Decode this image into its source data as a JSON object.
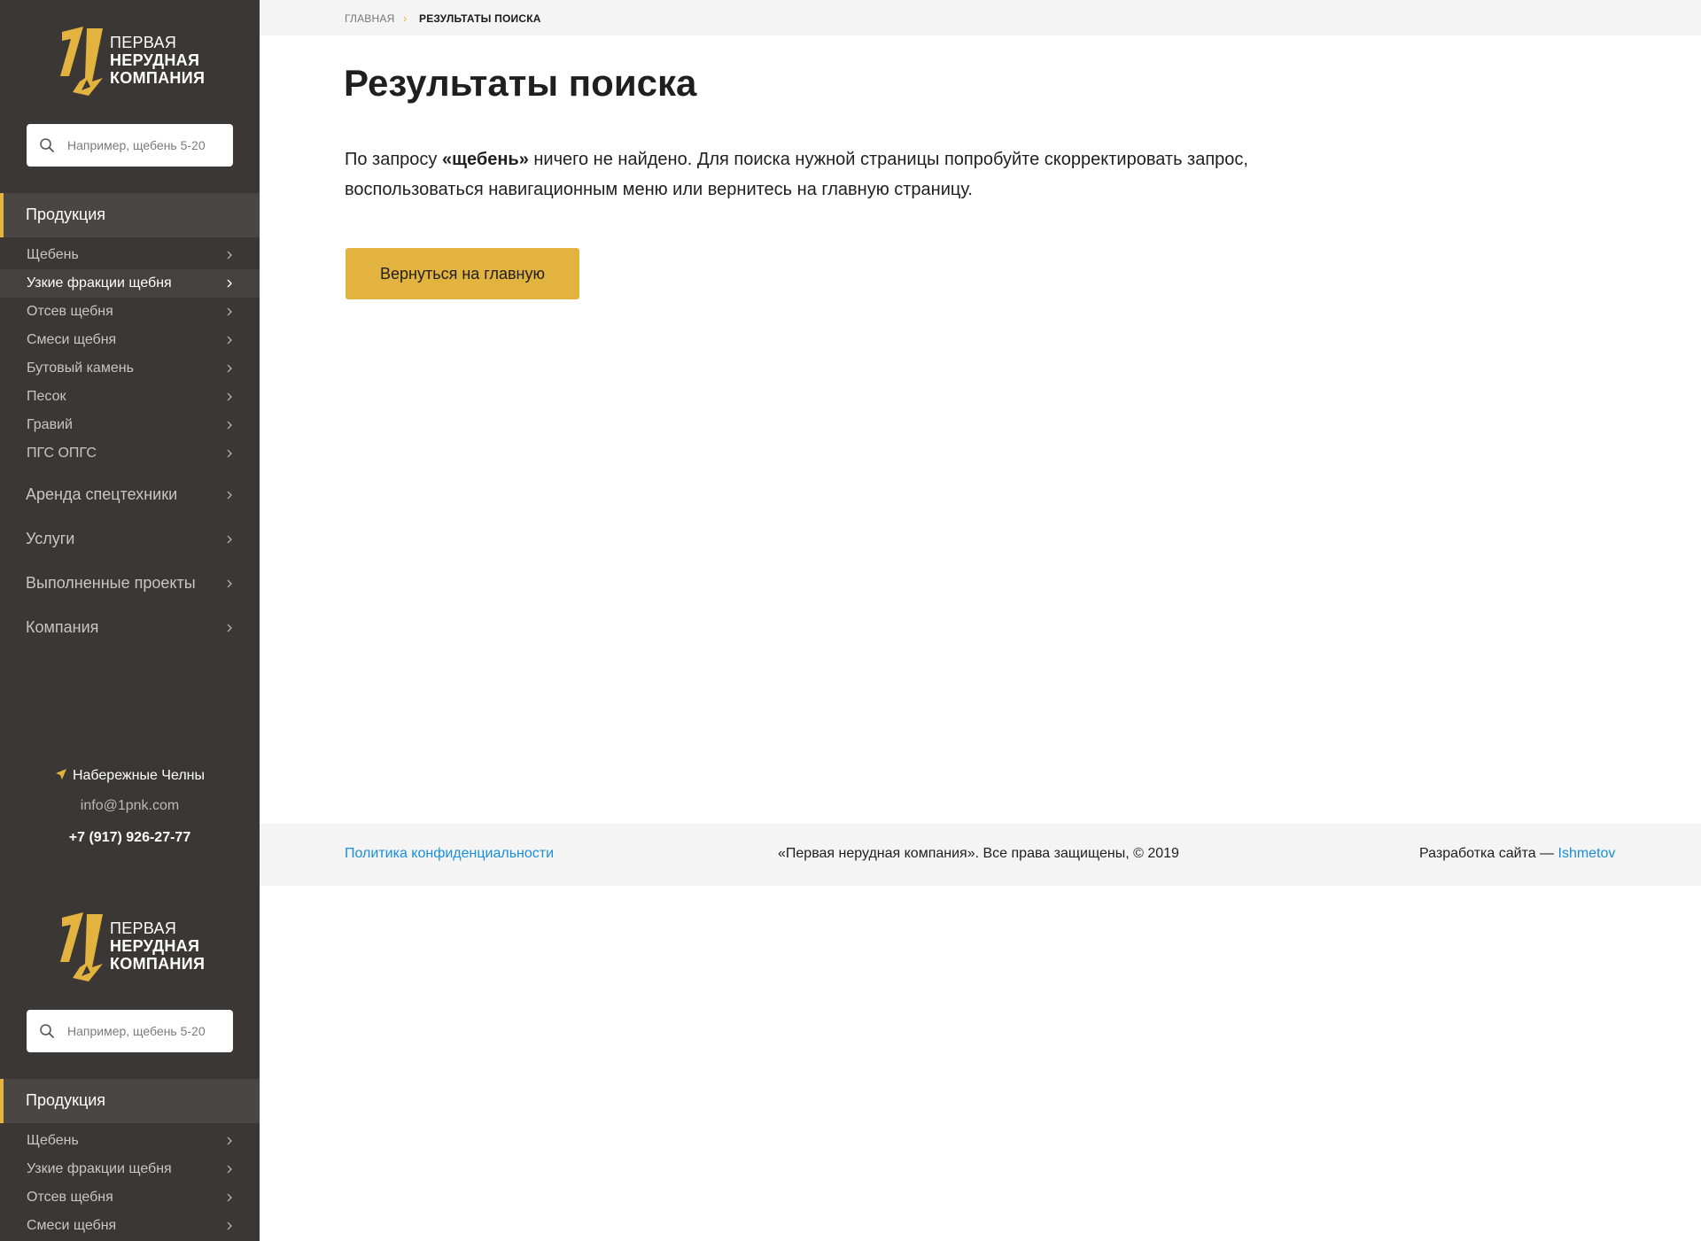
{
  "brand": {
    "line1": "ПЕРВАЯ",
    "line2": "НЕРУДНАЯ",
    "line3": "КОМПАНИЯ",
    "accent_color": "#e3b340",
    "sidebar_color": "#3a3734"
  },
  "search": {
    "placeholder": "Например, щебень 5-20"
  },
  "menu": {
    "section_title": "Продукция",
    "sub_items": [
      {
        "label": "Щебень"
      },
      {
        "label": "Узкие фракции щебня"
      },
      {
        "label": "Отсев щебня"
      },
      {
        "label": "Смеси щебня"
      },
      {
        "label": "Бутовый камень"
      },
      {
        "label": "Песок"
      },
      {
        "label": "Гравий"
      },
      {
        "label": "ПГС ОПГС"
      }
    ],
    "main_items": [
      {
        "label": "Аренда спецтехники"
      },
      {
        "label": "Услуги"
      },
      {
        "label": "Выполненные проекты"
      },
      {
        "label": "Компания"
      }
    ]
  },
  "contacts": {
    "city": "Набережные Челны",
    "email": "info@1pnk.com",
    "phone": "+7 (917) 926-27-77"
  },
  "breadcrumb": {
    "home": "Главная",
    "separator": "›",
    "current": "Результаты поиска"
  },
  "page": {
    "title": "Результаты поиска",
    "message_before": "По запросу ",
    "query": "«щебень»",
    "message_after": " ничего не найдено. Для поиска нужной страницы попробуйте скорректировать запрос, воспользоваться навигационным меню или вернитесь на главную страницу.",
    "button_label": "Вернуться на главную"
  },
  "footer": {
    "privacy": "Политика конфиденциальности",
    "copyright": "«Первая нерудная компания». Все права защищены, © 2019",
    "dev_prefix": "Разработка сайта — ",
    "dev_link": "Ishmetov"
  }
}
